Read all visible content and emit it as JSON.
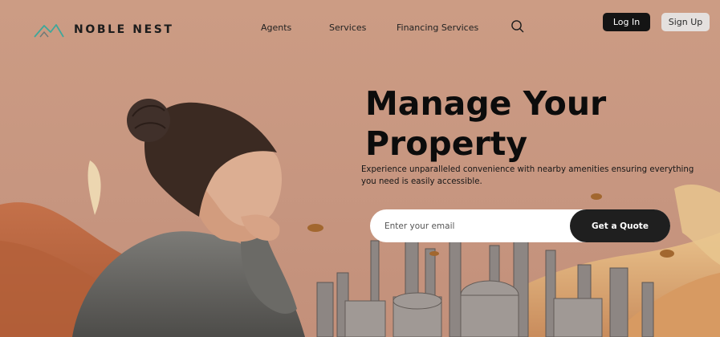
{
  "brand": {
    "name": "NOBLE NEST"
  },
  "nav": {
    "links": [
      {
        "label": "Agents"
      },
      {
        "label": "Services"
      },
      {
        "label": "Financing Services"
      }
    ],
    "login_label": "Log In",
    "signup_label": "Sign Up"
  },
  "hero": {
    "title_line1": "Manage Your",
    "title_line2": "Property",
    "subtitle": "Experience unparalleled convenience with nearby amenities ensuring everything you need is easily accessible.",
    "email_placeholder": "Enter your email",
    "email_value": "",
    "cta_label": "Get a Quote"
  },
  "colors": {
    "background": "#c99a82",
    "primary_button": "#141414",
    "secondary_button": "#e4e0de",
    "logo_accent": "#3fa79a"
  },
  "icons": [
    "logo-mountain-icon",
    "search-icon"
  ]
}
